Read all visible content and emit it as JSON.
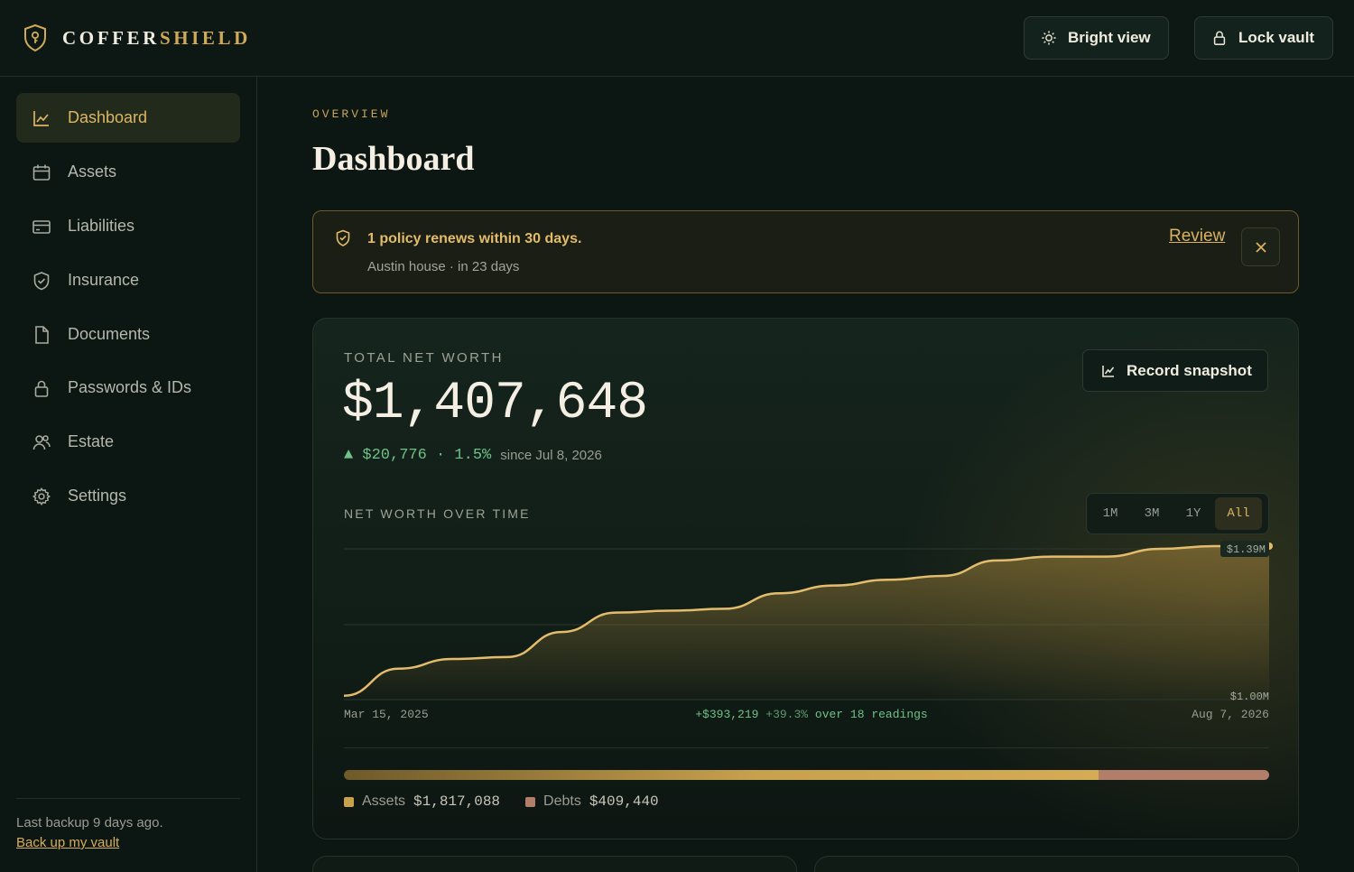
{
  "brand": {
    "name_a": "COFFER",
    "name_b": "SHIELD"
  },
  "header": {
    "bright_label": "Bright view",
    "lock_label": "Lock vault"
  },
  "sidebar": {
    "items": [
      {
        "label": "Dashboard",
        "icon": "chart-line-icon",
        "active": true
      },
      {
        "label": "Assets",
        "icon": "calendar-icon"
      },
      {
        "label": "Liabilities",
        "icon": "credit-card-icon"
      },
      {
        "label": "Insurance",
        "icon": "shield-check-icon"
      },
      {
        "label": "Documents",
        "icon": "document-icon"
      },
      {
        "label": "Passwords & IDs",
        "icon": "lock-icon"
      },
      {
        "label": "Estate",
        "icon": "people-icon"
      },
      {
        "label": "Settings",
        "icon": "gear-icon"
      }
    ],
    "backup_text": "Last backup 9 days ago.",
    "backup_link": "Back up my vault"
  },
  "main": {
    "eyebrow": "OVERVIEW",
    "title": "Dashboard",
    "alert": {
      "title": "1 policy renews within 30 days.",
      "subtitle": "Austin house · in 23 days",
      "review": "Review"
    },
    "networth": {
      "label": "TOTAL NET WORTH",
      "value": "$1,407,648",
      "delta": "▲ $20,776 · 1.5%",
      "since": "since Jul 8, 2026",
      "record_label": "Record snapshot"
    },
    "chart_title": "NET WORTH OVER TIME",
    "ranges": [
      "1M",
      "3M",
      "1Y",
      "All"
    ],
    "selected_range": "All",
    "breakdown": {
      "assets_label": "Assets",
      "assets_value": "$1,817,088",
      "debts_label": "Debts",
      "debts_value": "$409,440",
      "assets_share": 0.816
    }
  },
  "colors": {
    "accent": "#d6ae5c",
    "positive": "#6fc187",
    "debts": "#b27e6a",
    "bg": "#0c1612"
  },
  "chart_data": {
    "type": "area",
    "x": [
      "Mar 15, 2025",
      "",
      "",
      "",
      "",
      "",
      "",
      "",
      "",
      "",
      "",
      "",
      "",
      "",
      "",
      "",
      "",
      "Aug 7, 2026"
    ],
    "xlabel_start": "Mar 15, 2025",
    "xlabel_end": "Aug 7, 2026",
    "values_m": [
      1.01,
      1.08,
      1.105,
      1.11,
      1.175,
      1.225,
      1.23,
      1.235,
      1.275,
      1.295,
      1.31,
      1.32,
      1.36,
      1.37,
      1.37,
      1.39,
      1.405,
      1.408
    ],
    "ylim": [
      "$1.00M",
      "$1.39M"
    ],
    "ylim_values": [
      1.0,
      1.39
    ],
    "summary_change": "+$393,219",
    "summary_pct": "+39.3%",
    "summary_text": "over 18 readings",
    "grid": true
  }
}
